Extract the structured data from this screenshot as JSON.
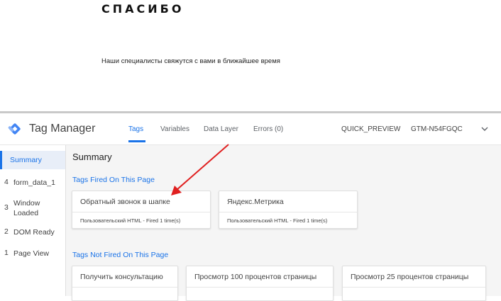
{
  "page": {
    "title": "СПАСИБО",
    "message": "Наши специалисты свяжутся с вами в ближайшее время"
  },
  "header": {
    "logo_text": "Tag Manager",
    "tabs": [
      {
        "label": "Tags",
        "active": true
      },
      {
        "label": "Variables",
        "active": false
      },
      {
        "label": "Data Layer",
        "active": false
      },
      {
        "label": "Errors (0)",
        "active": false
      }
    ],
    "preview_label": "QUICK_PREVIEW",
    "container_id": "GTM-N54FGQC"
  },
  "sidebar": {
    "items": [
      {
        "num": "",
        "label": "Summary",
        "active": true
      },
      {
        "num": "4",
        "label": "form_data_1"
      },
      {
        "num": "3",
        "label": "Window\nLoaded"
      },
      {
        "num": "2",
        "label": "DOM Ready"
      },
      {
        "num": "1",
        "label": "Page View"
      }
    ]
  },
  "main": {
    "title": "Summary",
    "fired_title": "Tags Fired On This Page",
    "fired": [
      {
        "name": "Обратный звонок в шапке",
        "status": "Пользовательский HTML - Fired 1 time(s)"
      },
      {
        "name": "Яндекс.Метрика",
        "status": "Пользовательский HTML - Fired 1 time(s)"
      }
    ],
    "not_fired_title": "Tags Not Fired On This Page",
    "not_fired": [
      {
        "name": "Получить консультацию"
      },
      {
        "name": "Просмотр 100 процентов страницы"
      },
      {
        "name": "Просмотр 25 процентов страницы"
      }
    ]
  },
  "colors": {
    "accent": "#1a73e8",
    "annotation_arrow": "#e02020"
  }
}
